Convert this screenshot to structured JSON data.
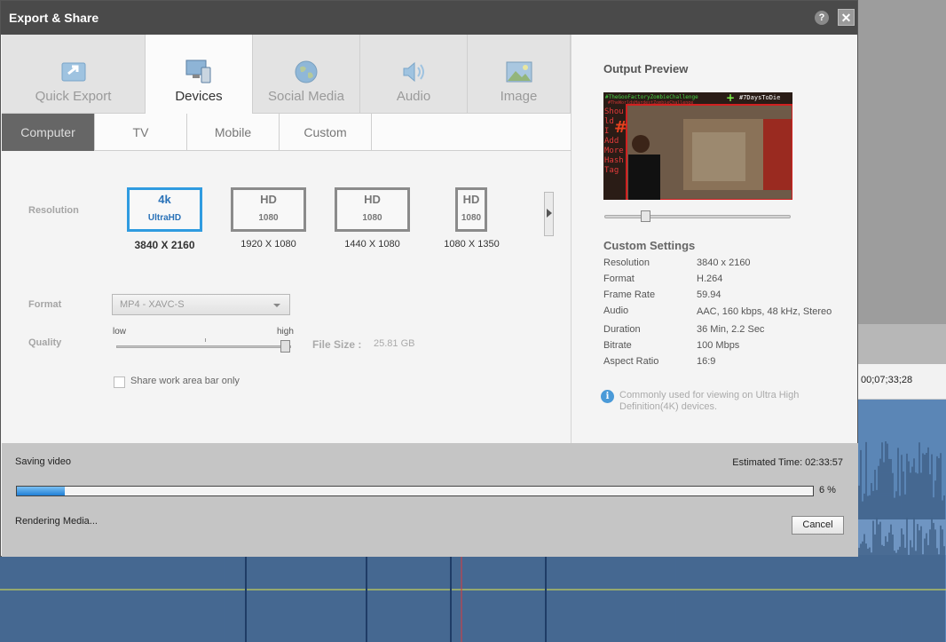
{
  "window": {
    "title": "Export & Share",
    "help": "?",
    "close": "✕"
  },
  "main_tabs": [
    {
      "label": "Quick Export",
      "icon": "quick-export-icon"
    },
    {
      "label": "Devices",
      "icon": "devices-icon",
      "active": true
    },
    {
      "label": "Social Media",
      "icon": "globe-icon"
    },
    {
      "label": "Audio",
      "icon": "speaker-icon"
    },
    {
      "label": "Image",
      "icon": "image-icon"
    }
  ],
  "sub_tabs": [
    {
      "label": "Computer",
      "active": true
    },
    {
      "label": "TV"
    },
    {
      "label": "Mobile"
    },
    {
      "label": "Custom"
    }
  ],
  "settings": {
    "resolution_label": "Resolution",
    "resolutions": [
      {
        "top": "4k",
        "bottom": "UltraHD",
        "caption": "3840 X 2160",
        "selected": true
      },
      {
        "top": "HD",
        "bottom": "1080",
        "caption": "1920 X 1080"
      },
      {
        "top": "HD",
        "bottom": "1080",
        "caption": "1440 X 1080"
      },
      {
        "top": "HD",
        "bottom": "1080",
        "caption": "1080 X 1350"
      }
    ],
    "format_label": "Format",
    "format_value": "MP4 - XAVC-S",
    "quality_label": "Quality",
    "quality_low": "low",
    "quality_high": "high",
    "quality_level": 1.0,
    "file_size_label": "File Size :",
    "file_size_value": "25.81 GB",
    "share_work_area_label": "Share work area bar only",
    "share_work_area_checked": false
  },
  "preview": {
    "title": "Output Preview",
    "overlay_top_left": "#TheGooFactoryZombieChallenge",
    "overlay_top_right": "#7DaysToDie",
    "overlay_sub_left": "#TheWorldsHardestZombieChallenge",
    "overlay_side_text": [
      "Shou",
      "ld",
      "I",
      "Add",
      "More",
      "Hash",
      "Tag"
    ],
    "slider_position": 0.22
  },
  "custom_settings": {
    "title": "Custom Settings",
    "rows": [
      {
        "key": "Resolution",
        "value": "3840 x 2160"
      },
      {
        "key": "Format",
        "value": "H.264"
      },
      {
        "key": "Frame Rate",
        "value": "59.94"
      },
      {
        "key": "Audio",
        "value": "AAC, 160 kbps, 48 kHz, Stereo"
      },
      {
        "key": "Duration",
        "value": "36 Min, 2.2 Sec"
      },
      {
        "key": "Bitrate",
        "value": "100 Mbps"
      },
      {
        "key": "Aspect Ratio",
        "value": "16:9"
      }
    ],
    "info_text": "Commonly used for viewing on Ultra High Definition(4K) devices."
  },
  "progress": {
    "saving_label": "Saving video",
    "estimated_time": "Estimated Time: 02:33:57",
    "percent": 6,
    "percent_text": "6 %",
    "status": "Rendering Media...",
    "cancel_label": "Cancel"
  },
  "background": {
    "timecode": "00;07;33;28"
  },
  "colors": {
    "accent_blue": "#2f9be0",
    "progress_blue": "#1f7fd6",
    "titlebar": "#4a4a4a",
    "waveform": "#5b86b6"
  }
}
